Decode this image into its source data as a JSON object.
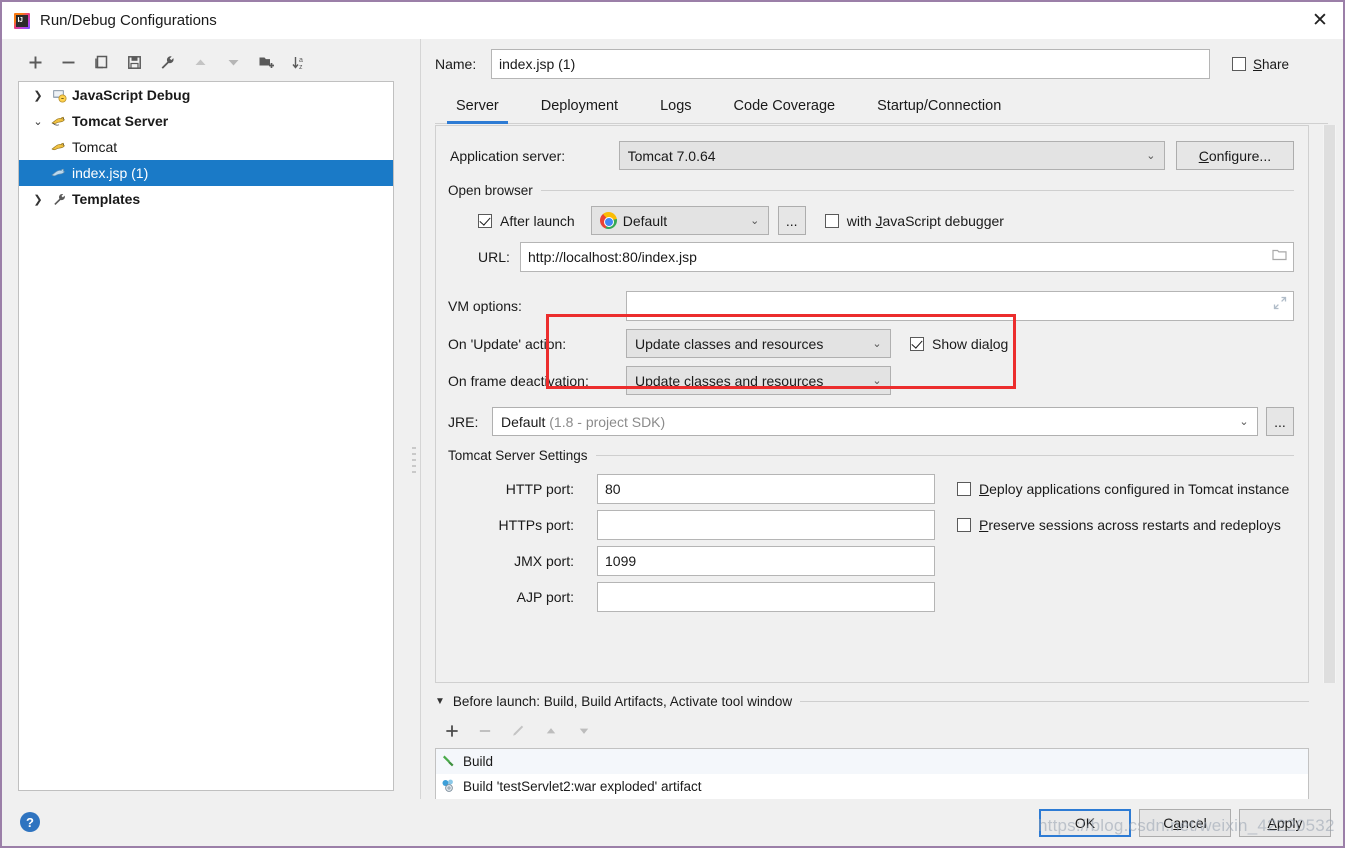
{
  "window": {
    "title": "Run/Debug Configurations",
    "app_icon": "intellij-idea-icon",
    "close_label": "✕"
  },
  "left_panel": {
    "toolbar": [
      {
        "name": "add-configuration-button",
        "icon": "plus-icon",
        "label": "+"
      },
      {
        "name": "remove-configuration-button",
        "icon": "minus-icon",
        "label": "−"
      },
      {
        "name": "copy-configuration-button",
        "icon": "copy-icon",
        "label": ""
      },
      {
        "name": "save-configuration-button",
        "icon": "save-icon",
        "label": ""
      },
      {
        "name": "edit-templates-button",
        "icon": "wrench-icon",
        "label": ""
      },
      {
        "name": "move-up-button",
        "icon": "arrow-up-icon",
        "label": ""
      },
      {
        "name": "move-down-button",
        "icon": "arrow-down-icon",
        "label": ""
      },
      {
        "name": "create-folder-button",
        "icon": "folder-add-icon",
        "label": ""
      },
      {
        "name": "sort-configurations-button",
        "icon": "sort-az-icon",
        "label": ""
      }
    ],
    "tree": [
      {
        "label": "JavaScript Debug",
        "icon": "javascript-debug-icon",
        "twisty": "collapsed",
        "bold": true,
        "level": 0,
        "selected": false
      },
      {
        "label": "Tomcat Server",
        "icon": "tomcat-icon",
        "twisty": "expanded",
        "bold": true,
        "level": 0,
        "selected": false
      },
      {
        "label": "Tomcat",
        "icon": "tomcat-icon",
        "twisty": "none",
        "bold": false,
        "level": 1,
        "selected": false
      },
      {
        "label": "index.jsp (1)",
        "icon": "tomcat-icon",
        "twisty": "none",
        "bold": false,
        "level": 1,
        "selected": true
      },
      {
        "label": "Templates",
        "icon": "wrench-icon",
        "twisty": "collapsed",
        "bold": true,
        "level": 0,
        "selected": false
      }
    ]
  },
  "right_panel": {
    "name_label": "Name:",
    "name_value": "index.jsp (1)",
    "share_label": "Share",
    "share_checked": false,
    "tabs": [
      {
        "label": "Server",
        "active": true
      },
      {
        "label": "Deployment",
        "active": false
      },
      {
        "label": "Logs",
        "active": false
      },
      {
        "label": "Code Coverage",
        "active": false
      },
      {
        "label": "Startup/Connection",
        "active": false
      }
    ],
    "app_server": {
      "label": "Application server:",
      "value": "Tomcat 7.0.64",
      "configure_label": "Configure..."
    },
    "open_browser": {
      "group_label": "Open browser",
      "after_launch_label": "After launch",
      "after_launch_checked": true,
      "browser_value": "Default",
      "browser_icon": "chrome-icon",
      "ellipsis_label": "...",
      "js_debugger_label": "with JavaScript debugger",
      "js_debugger_checked": false,
      "url_label": "URL:",
      "url_value": "http://localhost:80/index.jsp"
    },
    "vm_options": {
      "label": "VM options:",
      "value": "",
      "expand_icon": "expand-diagonal-icon"
    },
    "on_update": {
      "label": "On 'Update' action:",
      "value": "Update classes and resources",
      "show_dialog_label": "Show dialog",
      "show_dialog_checked": true
    },
    "on_frame_deactivation": {
      "label": "On frame deactivation:",
      "value": "Update classes and resources"
    },
    "jre": {
      "label": "JRE:",
      "value": "Default",
      "value_hint": "(1.8 - project SDK)",
      "browse_label": "..."
    },
    "tomcat_settings": {
      "group_label": "Tomcat Server Settings",
      "fields": [
        {
          "label": "HTTP port:",
          "value": "80",
          "name": "http-port-field"
        },
        {
          "label": "HTTPs port:",
          "value": "",
          "name": "https-port-field"
        },
        {
          "label": "JMX port:",
          "value": "1099",
          "name": "jmx-port-field"
        },
        {
          "label": "AJP port:",
          "value": "",
          "name": "ajp-port-field"
        }
      ],
      "checkboxes": [
        {
          "label": "Deploy applications configured in Tomcat instance",
          "checked": false,
          "name": "deploy-applications-checkbox",
          "mnemonic": "D"
        },
        {
          "label": "Preserve sessions across restarts and redeploys",
          "checked": false,
          "name": "preserve-sessions-checkbox",
          "mnemonic": "P"
        }
      ]
    },
    "before_launch": {
      "header": "Before launch: Build, Build Artifacts, Activate tool window",
      "toolbar": [
        {
          "name": "before-launch-add-button",
          "icon": "plus-icon"
        },
        {
          "name": "before-launch-remove-button",
          "icon": "minus-icon"
        },
        {
          "name": "before-launch-edit-button",
          "icon": "pencil-icon"
        },
        {
          "name": "before-launch-move-up-button",
          "icon": "arrow-up-icon"
        },
        {
          "name": "before-launch-move-down-button",
          "icon": "arrow-down-icon"
        }
      ],
      "items": [
        {
          "label": "Build",
          "icon": "build-hammer-icon"
        },
        {
          "label": "Build 'testServlet2:war exploded' artifact",
          "icon": "artifact-icon"
        }
      ]
    }
  },
  "bottom_bar": {
    "help_label": "?",
    "buttons": [
      {
        "label": "OK",
        "name": "ok-button",
        "default": true
      },
      {
        "label": "Cancel",
        "name": "cancel-button",
        "default": false
      },
      {
        "label": "Apply",
        "name": "apply-button",
        "default": false
      }
    ],
    "watermark": "https://blog.csdn.net/weixin_42220532"
  },
  "annotation": {
    "highlight_color": "#ec2d2d",
    "accent_color": "#2d7bd4",
    "selection_color": "#1a7ac7"
  }
}
